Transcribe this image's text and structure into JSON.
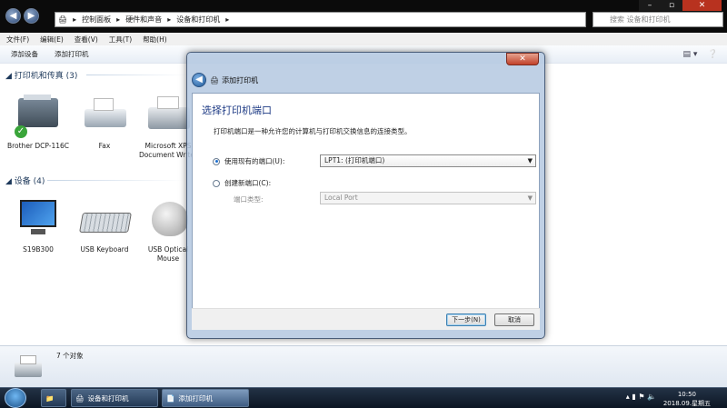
{
  "explorer": {
    "breadcrumb": [
      "控制面板",
      "硬件和声音",
      "设备和打印机"
    ],
    "search_placeholder": "搜索 设备和打印机",
    "menu": [
      "文件(F)",
      "编辑(E)",
      "查看(V)",
      "工具(T)",
      "帮助(H)"
    ],
    "toolbar": [
      "添加设备",
      "添加打印机"
    ],
    "group_printers": "打印机和传真 (3)",
    "printers": [
      {
        "label": "Brother DCP-116C"
      },
      {
        "label": "Fax"
      },
      {
        "label": "Microsoft XPS Document Writer"
      }
    ],
    "group_devices": "设备 (4)",
    "devices": [
      {
        "label": "S19B300"
      },
      {
        "label": "USB Keyboard"
      },
      {
        "label": "USB Optical Mouse"
      }
    ],
    "status_count": "7 个对象"
  },
  "dialog": {
    "title": "添加打印机",
    "heading": "选择打印机端口",
    "description": "打印机端口是一种允许您的计算机与打印机交换信息的连接类型。",
    "use_existing_label": "使用现有的端口(U):",
    "use_existing_value": "LPT1: (打印机端口)",
    "create_new_label": "创建新端口(C):",
    "port_type_label": "端口类型:",
    "port_type_value": "Local Port",
    "next_button": "下一步(N)",
    "cancel_button": "取消",
    "selected_option": "use_existing"
  },
  "taskbar": {
    "tasks": [
      "设备和打印机",
      "添加打印机"
    ],
    "time": "10:50",
    "date": "2018.09.星期五"
  }
}
